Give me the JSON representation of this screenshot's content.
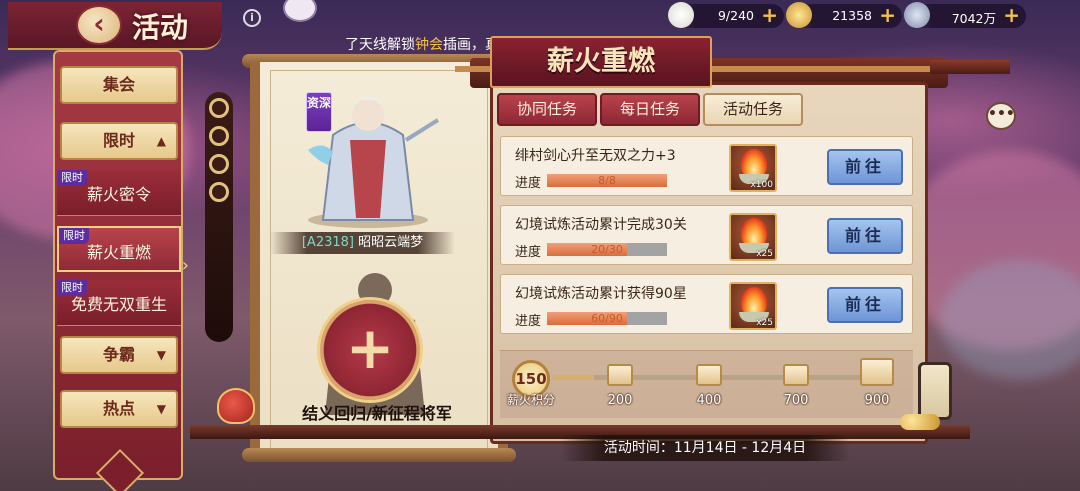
{
  "header": {
    "back_icon": "chevron-left-icon",
    "title": "活动",
    "info_icon": "info-icon",
    "marquee_prefix": "了天线解锁",
    "marquee_highlight": "钟会",
    "marquee_suffix": "插画，真爱满满！"
  },
  "resources": [
    {
      "icon": "rice-bun-icon",
      "value": "9/240"
    },
    {
      "icon": "gold-ingot-icon",
      "value": "21358"
    },
    {
      "icon": "coin-icon",
      "value": "7042万"
    }
  ],
  "left_nav": {
    "items": [
      {
        "label": "集会"
      },
      {
        "label": "限时",
        "chevron": "▲"
      },
      {
        "label": "争霸",
        "chevron": "▼"
      },
      {
        "label": "热点",
        "chevron": "▼"
      }
    ],
    "sub_items": [
      {
        "tag": "限时",
        "label": "薪火密令"
      },
      {
        "tag": "限时",
        "label": "薪火重燃",
        "active": true
      },
      {
        "tag": "限时",
        "label": "免费无双重生"
      }
    ]
  },
  "general": {
    "tag": "资深",
    "code": "[A2318]",
    "name": "昭昭云端梦",
    "recruit_label": "结义回归/新征程将军"
  },
  "event": {
    "title": "薪火重燃",
    "tabs": [
      {
        "label": "协同任务"
      },
      {
        "label": "每日任务"
      },
      {
        "label": "活动任务",
        "active": true
      }
    ],
    "tasks": [
      {
        "title": "绯村剑心升至无双之力+3",
        "progress_label": "进度",
        "progress_text": "8/8",
        "progress": 1.0,
        "reward_qty": "x100",
        "go_label": "前往"
      },
      {
        "title": "幻境试炼活动累计完成30关",
        "progress_label": "进度",
        "progress_text": "20/30",
        "progress": 0.6667,
        "reward_qty": "x25",
        "go_label": "前往"
      },
      {
        "title": "幻境试炼活动累计获得90星",
        "progress_label": "进度",
        "progress_text": "60/90",
        "progress": 0.6667,
        "reward_qty": "x25",
        "go_label": "前往"
      }
    ],
    "points": {
      "value": "150",
      "label": "薪火积分",
      "progress": 0.125,
      "milestones": [
        "200",
        "400",
        "700",
        "900"
      ]
    },
    "time_text": "活动时间：11月14日 - 12月4日"
  },
  "colors": {
    "accent_red": "#8e2735",
    "gold_border": "#d7ad69",
    "highlight": "#f4c046",
    "go_button": "#6d95d6"
  }
}
